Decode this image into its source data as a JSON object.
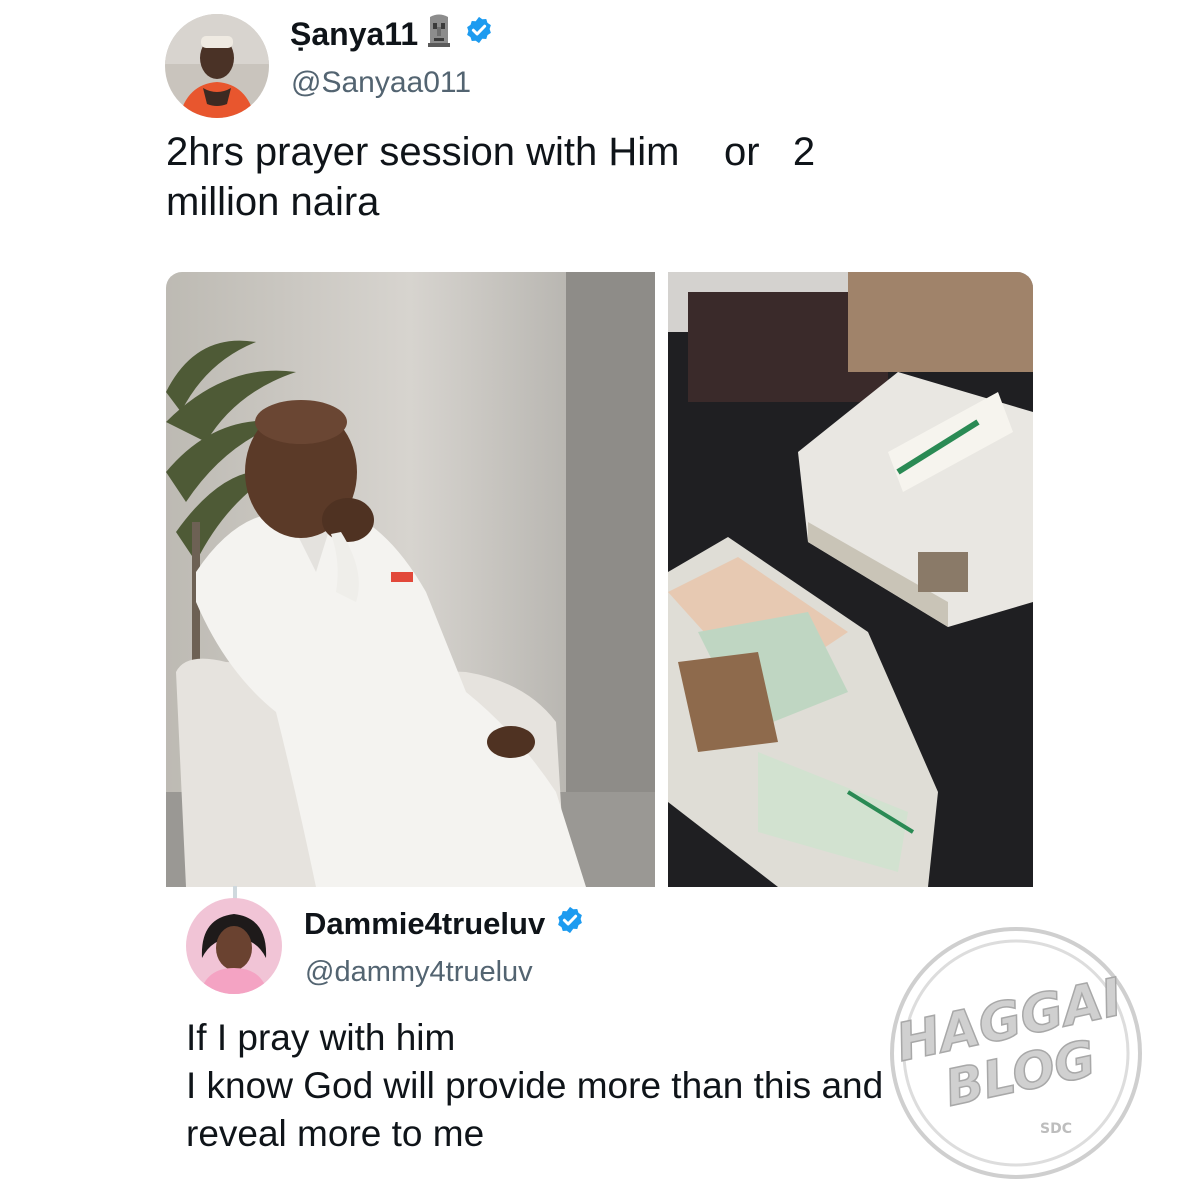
{
  "tweet": {
    "display_name": "Ṣanya11",
    "name_emoji": "moai-emoji",
    "verified_icon": "verified-badge-icon",
    "handle": "@Sanyaa011",
    "text": "2hrs prayer session with Him    or   2\nmillion naira",
    "media": [
      {
        "icon": "photo-man-in-white-suit"
      },
      {
        "icon": "photo-naira-cash-bundles"
      }
    ]
  },
  "reply": {
    "display_name": "Dammie4trueluv",
    "verified_icon": "verified-badge-icon",
    "handle": "@dammy4trueluv",
    "text": "If I pray with him\nI know God will provide more than this and\nreveal more to me"
  },
  "watermark": {
    "line1": "HAGGAI",
    "line2": "BLOG",
    "tag": "SDC"
  },
  "colors": {
    "verified_blue": "#1d9bf0",
    "handle_gray": "#536471",
    "text": "#0f1419"
  }
}
